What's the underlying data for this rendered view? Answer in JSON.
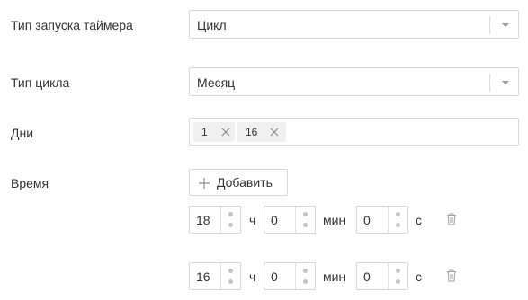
{
  "form": {
    "timer_start_type": {
      "label": "Тип запуска таймера",
      "value": "Цикл"
    },
    "cycle_type": {
      "label": "Тип цикла",
      "value": "Месяц"
    },
    "days": {
      "label": "Дни",
      "tags": [
        "1",
        "16"
      ]
    },
    "time": {
      "label": "Время",
      "add_label": "Добавить",
      "rows": [
        {
          "hours": "18",
          "minutes": "0",
          "seconds": "0"
        },
        {
          "hours": "16",
          "minutes": "0",
          "seconds": "0"
        }
      ],
      "unit_hours": "ч",
      "unit_minutes": "мин",
      "unit_seconds": "с"
    }
  },
  "colors": {
    "border": "#d9d9d9",
    "text": "#333333",
    "tag_bg": "#f0f0f0",
    "icon": "#9b9b9b"
  }
}
